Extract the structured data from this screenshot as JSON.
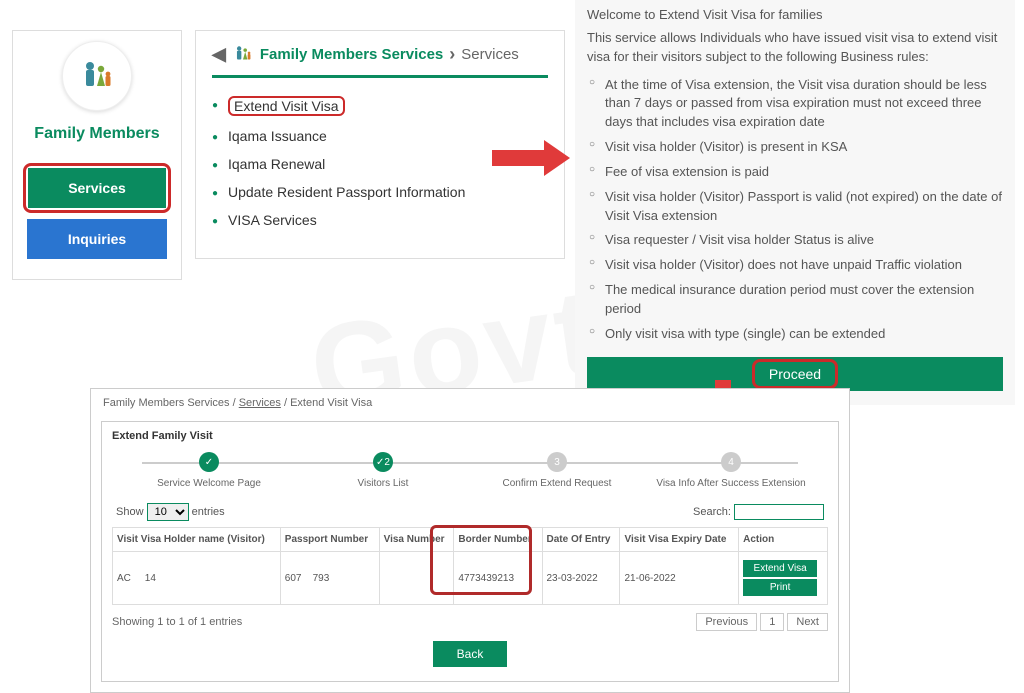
{
  "sidebar": {
    "title": "Family Members",
    "services_btn": "Services",
    "inquiries_btn": "Inquiries"
  },
  "mid": {
    "bc_title": "Family Members Services",
    "bc_services": "Services",
    "items": [
      "Extend Visit Visa",
      "Iqama Issuance",
      "Iqama Renewal",
      "Update Resident Passport Information",
      "VISA Services"
    ]
  },
  "right": {
    "welcome": "Welcome to Extend Visit Visa for families",
    "intro": "This service allows Individuals who have issued visit visa to extend visit visa for their visitors subject to the following Business rules:",
    "rules": [
      "At the time of Visa extension, the Visit visa duration should be less than 7 days or passed from visa expiration must not exceed three days that includes visa expiration date",
      "Visit visa holder (Visitor) is present in KSA",
      "Fee of visa extension is paid",
      "Visit visa holder (Visitor) Passport is valid (not expired) on the date of Visit Visa extension",
      "Visa requester / Visit visa holder Status is alive",
      "Visit visa holder (Visitor) does not have unpaid Traffic violation",
      "The medical insurance duration period must cover the extension period",
      "Only visit visa with type (single) can be extended"
    ],
    "proceed": "Proceed"
  },
  "bottom": {
    "crumb1": "Family Members Services",
    "crumb2": "Services",
    "crumb3": "Extend Visit Visa",
    "box_title": "Extend Family Visit",
    "steps": [
      "Service Welcome Page",
      "Visitors List",
      "Confirm Extend Request",
      "Visa Info After Success Extension"
    ],
    "show": "Show",
    "entries": "entries",
    "search": "Search:",
    "cols": [
      "Visit Visa Holder name (Visitor)",
      "Passport Number",
      "Visa Number",
      "Border Number",
      "Date Of Entry",
      "Visit Visa Expiry Date",
      "Action"
    ],
    "row": {
      "name": "AC     14",
      "passport": "607    793",
      "visa": "",
      "border": "4773439213",
      "entry": "23-03-2022",
      "expiry": "21-06-2022"
    },
    "extend_btn": "Extend Visa",
    "print_btn": "Print",
    "showing": "Showing 1 to 1 of 1 entries",
    "previous": "Previous",
    "page": "1",
    "next": "Next",
    "back": "Back"
  }
}
